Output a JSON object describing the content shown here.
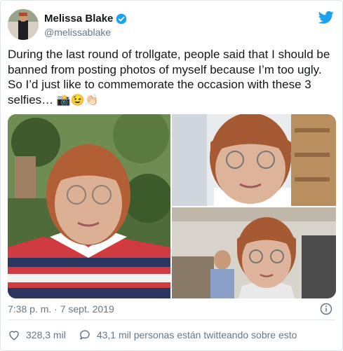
{
  "author": {
    "display_name": "Melissa Blake",
    "handle": "@melissablake",
    "verified_icon": "verified-badge-icon",
    "avatar": "avatar"
  },
  "brand": {
    "icon": "twitter-bird-icon",
    "color": "#1da1f2"
  },
  "tweet": {
    "text": "During the last round of trollgate, people said that I should be banned from posting photos of myself because I’m too ugly. So I’d just like to commemorate the occasion with these 3 selfies…",
    "emojis": "📸😉👏🏻"
  },
  "media": [
    "selfie-photo-1",
    "selfie-photo-2",
    "selfie-photo-3"
  ],
  "timestamp": "7:38 p. m. · 7 sept. 2019",
  "stats": {
    "likes": "328,3 mil",
    "replies_text": "43,1 mil personas están twitteando sobre esto"
  },
  "colors": {
    "text": "#14171a",
    "secondary": "#657786",
    "border": "#e1e8ed",
    "accent": "#1da1f2"
  }
}
